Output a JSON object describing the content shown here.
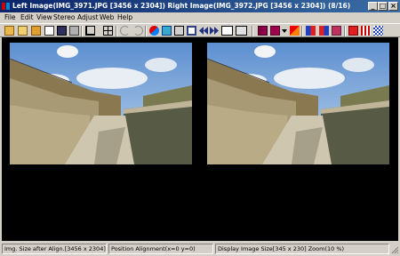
{
  "window": {
    "title": "Left Image(IMG_3971.JPG [3456 x 2304]) Right Image(IMG_3972.JPG [3456 x 2304]) (8/16)",
    "minimize_label": "_",
    "maximize_label": "□",
    "close_label": "×"
  },
  "menu": [
    "File",
    "Edit",
    "View",
    "Stereo",
    "Adjust",
    "Web",
    "Help"
  ],
  "toolbar": {
    "icons": [
      "open-folder-icon",
      "open-file-icon",
      "save-folder-icon",
      "copy-icon",
      "save-icon",
      "print-icon",
      "crop-icon",
      "grid-icon",
      "undo-icon",
      "redo-icon",
      "swap-icon",
      "left-view-icon",
      "right-view-icon",
      "side-by-side-icon",
      "prev-icon",
      "next-icon",
      "fit-icon",
      "zoom-icon",
      "red-cyan-icon",
      "red-blue-icon",
      "anaglyph-dropdown-icon",
      "interlace-icon",
      "mirror-icon",
      "color-icon",
      "flag-icon",
      "red-settings-icon",
      "pattern-icon",
      "checker-icon"
    ]
  },
  "statusbar": {
    "image_size": "Img. Size after Align.[3456 x 2304]",
    "position": "Position Alignment(x=0 y=0)",
    "display": "Display Image Size[345 x 230]  Zoom(10 %)"
  }
}
